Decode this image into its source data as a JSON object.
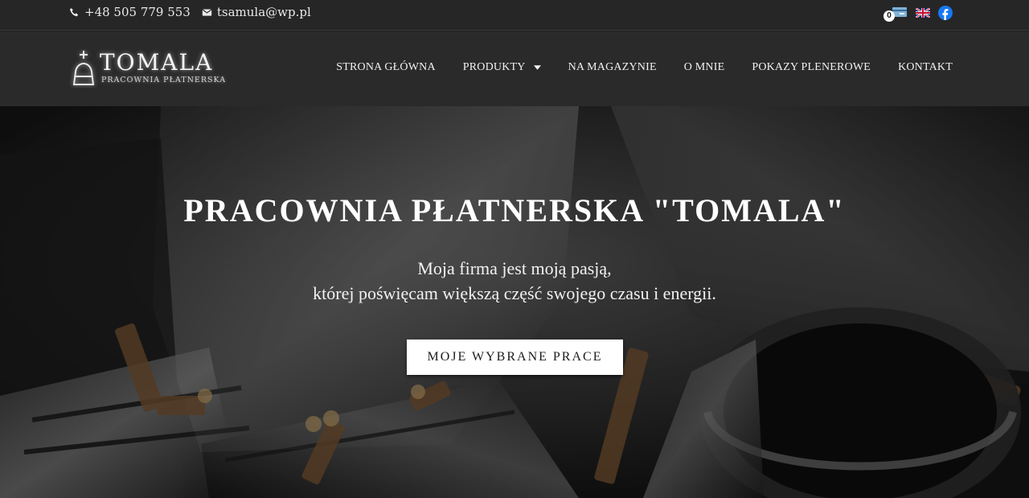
{
  "topbar": {
    "phone": "+48 505 779 553",
    "email": "tsamula@wp.pl",
    "cart_count": "0",
    "icons": [
      "phone-icon",
      "envelope-icon",
      "cart-icon",
      "uk-flag-icon",
      "facebook-icon"
    ]
  },
  "logo": {
    "name": "TOMALA",
    "subtitle": "PRACOWNIA PŁATNERSKA"
  },
  "nav": {
    "items": [
      {
        "label": "STRONA GŁÓWNA"
      },
      {
        "label": "PRODUKTY"
      },
      {
        "label": "NA MAGAZYNIE"
      },
      {
        "label": "O MNIE"
      },
      {
        "label": "POKAZY PLENEROWE"
      },
      {
        "label": "KONTAKT"
      }
    ]
  },
  "hero": {
    "title": "PRACOWNIA PŁATNERSKA \"TOMALA\"",
    "line1": "Moja firma jest moją pasją,",
    "line2": "której poświęcam większą część swojego czasu i energii.",
    "button": "MOJE WYBRANE PRACE"
  },
  "colors": {
    "topbar_bg": "#262626",
    "header_bg": "#2a2a2a",
    "facebook": "#1877f2",
    "button_bg": "#ffffff"
  }
}
